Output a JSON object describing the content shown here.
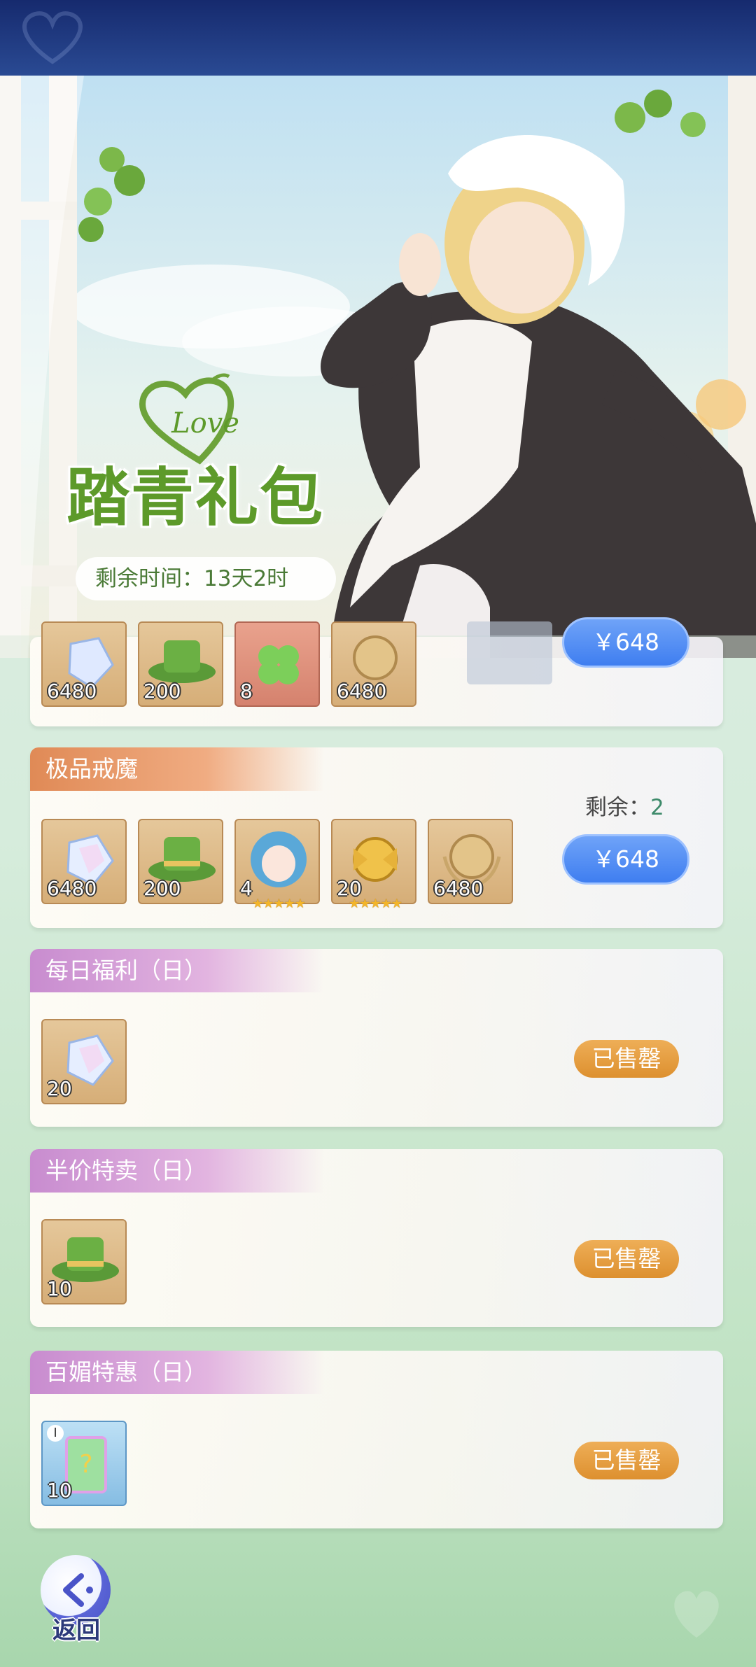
{
  "banner": {
    "logo_script": "Love",
    "title": "踏青礼包",
    "timer": "剩余时间：13天2时"
  },
  "packs": [
    {
      "name": "",
      "price": "￥648",
      "items": [
        {
          "icon": "crystal-icon",
          "qty": "6480"
        },
        {
          "icon": "green-hat-icon",
          "qty": "200"
        },
        {
          "icon": "clover-icon",
          "qty": "8"
        },
        {
          "icon": "noble-badge-icon",
          "qty": "6480"
        }
      ]
    },
    {
      "name": "极品戒魔",
      "remain_label": "剩余：",
      "remain_value": "2",
      "price": "￥648",
      "items": [
        {
          "icon": "crystal-icon",
          "qty": "6480"
        },
        {
          "icon": "green-hat-icon",
          "qty": "200"
        },
        {
          "icon": "character-avatar-icon",
          "qty": "4",
          "stars": "★★★★★"
        },
        {
          "icon": "golden-emblem-icon",
          "qty": "20",
          "stars": "★★★★★"
        },
        {
          "icon": "noble-badge-icon",
          "qty": "6480"
        }
      ]
    },
    {
      "name": "每日福利（日）",
      "status": "已售罄",
      "items": [
        {
          "icon": "crystal-icon",
          "qty": "20"
        }
      ]
    },
    {
      "name": "半价特卖（日）",
      "status": "已售罄",
      "items": [
        {
          "icon": "green-hat-icon",
          "qty": "10"
        }
      ]
    },
    {
      "name": "百媚特惠（日）",
      "status": "已售罄",
      "items": [
        {
          "icon": "mystery-card-icon",
          "qty": "10",
          "badge": "I"
        }
      ]
    }
  ],
  "back_label": "返回",
  "colors": {
    "topbar": "#1f3a82",
    "price_button": "#4a86f2",
    "soldout_button": "#e39a3c",
    "tag_orange": "#e08a56",
    "tag_pink": "#c88ccf"
  }
}
